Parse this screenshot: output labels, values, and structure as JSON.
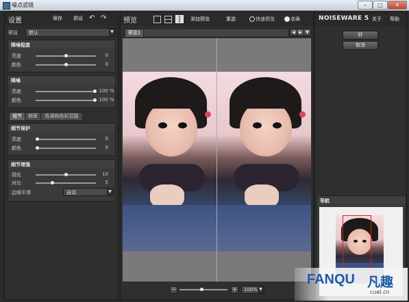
{
  "window": {
    "title": "噪点滤镜",
    "minimize": "–",
    "maximize": "□",
    "close": "✕"
  },
  "left": {
    "header": {
      "title": "设置",
      "save": "保存",
      "preset": "预设"
    },
    "preset": {
      "label": "预设",
      "value": "默认"
    },
    "noise_level": {
      "title": "降噪程度",
      "rows": [
        {
          "label": "亮度",
          "value": "0",
          "level": 0.5
        },
        {
          "label": "颜色",
          "value": "0",
          "level": 0.5
        }
      ]
    },
    "denoise": {
      "title": "降噪",
      "rows": [
        {
          "label": "亮度",
          "value": "100",
          "unit": "%",
          "level": 1.0
        },
        {
          "label": "颜色",
          "value": "100",
          "unit": "%",
          "level": 1.0
        }
      ]
    },
    "tabs": [
      "细节",
      "频率",
      "色调和色彩范围"
    ],
    "detail_protect": {
      "title": "细节保护",
      "rows": [
        {
          "label": "亮度",
          "value": "0",
          "level": 0.0
        },
        {
          "label": "颜色",
          "value": "0",
          "level": 0.0
        }
      ]
    },
    "detail_enhance": {
      "title": "细节增强",
      "rows": [
        {
          "label": "锐化",
          "value": "10",
          "level": 0.5
        },
        {
          "label": "对比",
          "value": "5",
          "level": 0.25
        }
      ],
      "edge": {
        "label": "边缘平滑",
        "value": "自动"
      }
    }
  },
  "center": {
    "header": {
      "title": "预览",
      "add_preview": "添加预览",
      "reset": "重选",
      "fast_preview": "快速预览",
      "accurate": "准确"
    },
    "tab": "预览1",
    "zoom": {
      "minus": "−",
      "plus": "+",
      "value": "100%",
      "level": 0.5
    }
  },
  "right": {
    "brand": "NOISEWARE 5",
    "about": "关于",
    "help": "帮助",
    "ok": "好",
    "cancel": "取消",
    "navigator": "导航"
  },
  "watermark": {
    "text": "FANQU",
    "cn": "凡趣",
    "url": "cuel.cn"
  }
}
